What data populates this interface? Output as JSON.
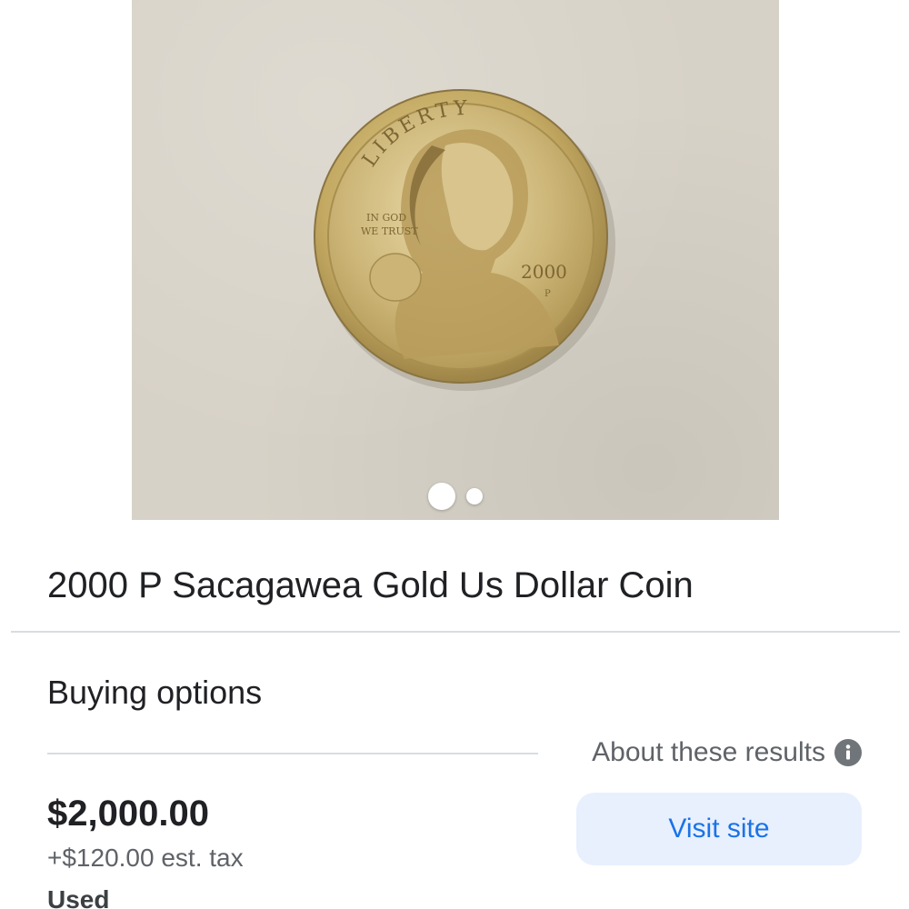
{
  "product": {
    "title": "2000 P Sacagawea Gold Us Dollar Coin",
    "image": {
      "description_icon": "coin-photo",
      "coin_inscriptions": {
        "top": "LIBERTY",
        "motto_line1": "IN GOD",
        "motto_line2": "WE TRUST",
        "year": "2000",
        "mint_mark": "P"
      },
      "carousel": {
        "total": 2,
        "active_index": 0
      }
    }
  },
  "buying_options": {
    "heading": "Buying options",
    "about_results": "About these results",
    "offer": {
      "price": "$2,000.00",
      "tax": "+$120.00 est. tax",
      "condition": "Used",
      "cta_label": "Visit site"
    }
  },
  "colors": {
    "accent_blue": "#1a73e8",
    "button_bg": "#e8f0fe",
    "divider": "#dadce0",
    "secondary_text": "#5f6368"
  }
}
